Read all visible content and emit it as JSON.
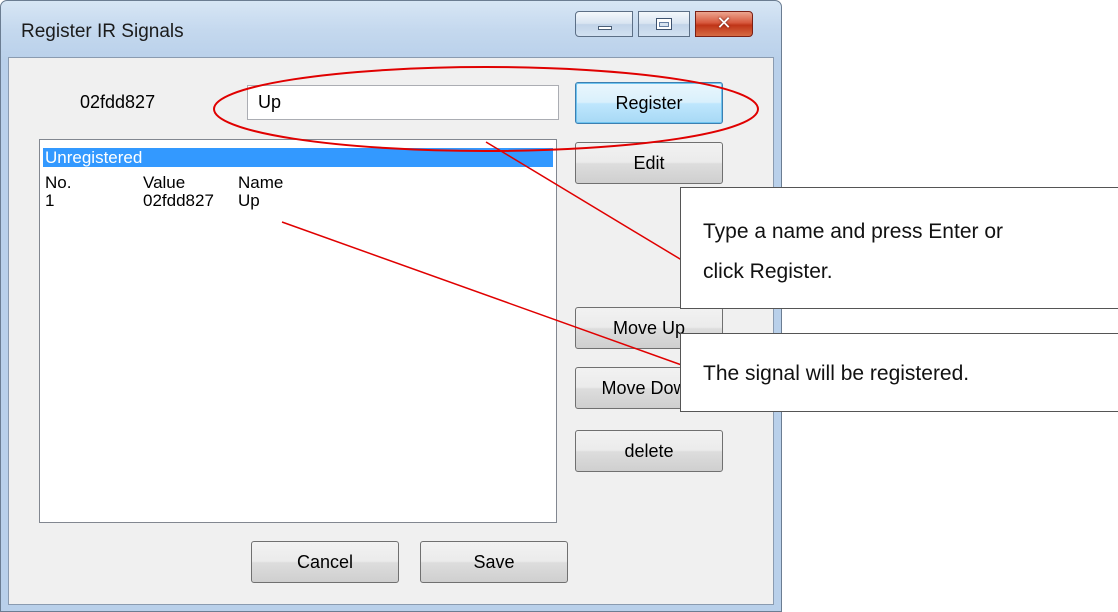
{
  "window": {
    "title": "Register IR Signals",
    "controls": {
      "minimize_icon": "minimize-icon",
      "maximize_icon": "maximize-icon",
      "close_icon": "close-icon"
    }
  },
  "signal": {
    "value": "02fdd827"
  },
  "name_input": {
    "value": "Up"
  },
  "buttons": {
    "register": "Register",
    "edit": "Edit",
    "move_up": "Move Up",
    "move_down": "Move Down",
    "delete": "delete",
    "cancel": "Cancel",
    "save": "Save"
  },
  "list": {
    "group_header": "Unregistered",
    "columns": [
      "No.",
      "Value",
      "Name"
    ],
    "rows": [
      {
        "no": "1",
        "value": "02fdd827",
        "name": "Up"
      }
    ]
  },
  "annotations": {
    "callout_1": {
      "line1": "Type a name and press Enter or",
      "line2": "click Register."
    },
    "callout_2": "The signal will be registered.",
    "color": "#e00000"
  }
}
